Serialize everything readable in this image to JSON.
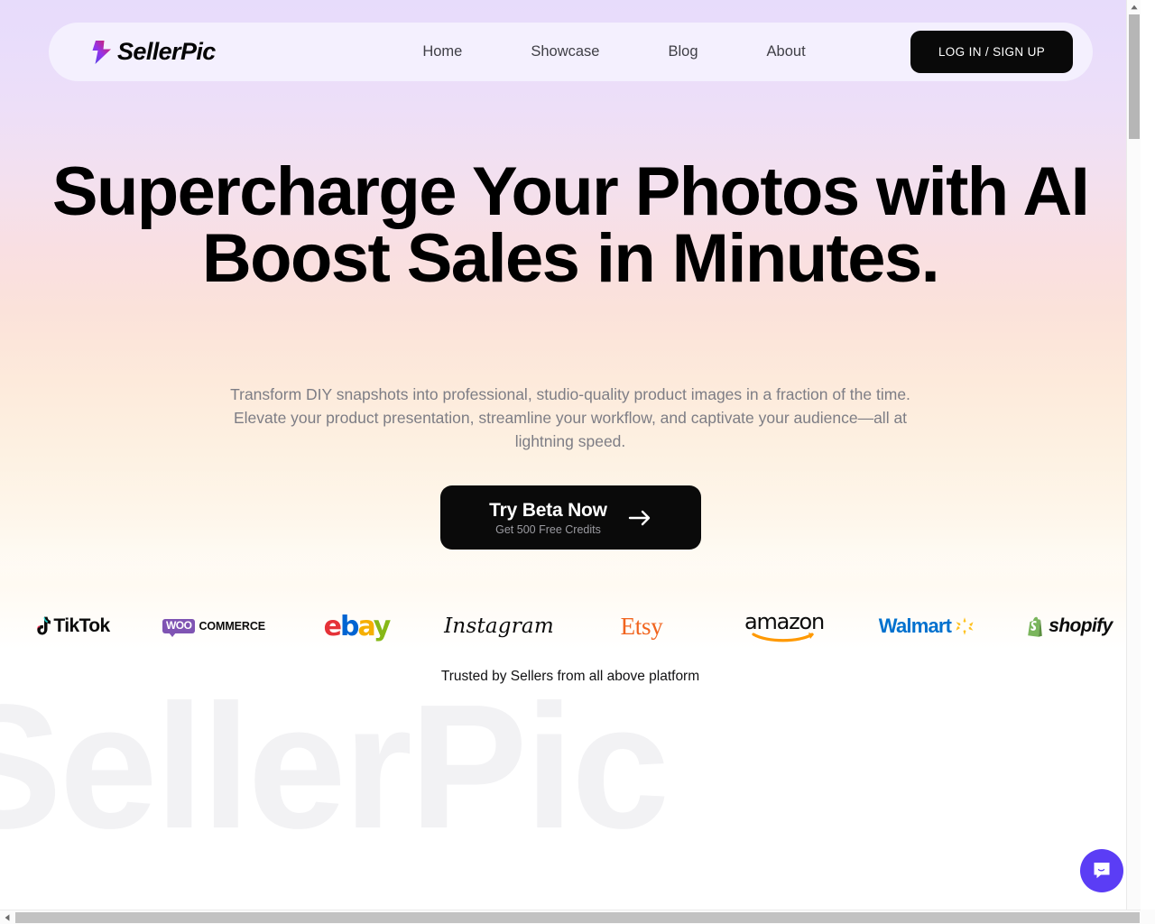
{
  "header": {
    "logo_text": "SellerPic",
    "logo_icon": "lightning-bolt-icon",
    "nav": [
      {
        "label": "Home"
      },
      {
        "label": "Showcase"
      },
      {
        "label": "Blog"
      },
      {
        "label": "About"
      }
    ],
    "login_label": "LOG IN / SIGN UP"
  },
  "hero": {
    "headline_line1": "Supercharge Your Photos with AI",
    "headline_line2": "Boost Sales in Minutes.",
    "subhead": "Transform DIY snapshots into professional, studio-quality product images in a fraction of the time. Elevate your product presentation, streamline your workflow, and captivate your audience—all at lightning speed.",
    "cta_title": "Try Beta Now",
    "cta_sub": "Get 500 Free Credits",
    "cta_arrow_icon": "arrow-right-icon"
  },
  "brands": {
    "trusted_label": "Trusted by Sellers from all above platform",
    "items": [
      {
        "name": "TikTok",
        "label": "TikTok"
      },
      {
        "name": "WooCommerce",
        "badge": "WOO",
        "label": "COMMERCE"
      },
      {
        "name": "eBay",
        "letters": {
          "e": "e",
          "b": "b",
          "a": "a",
          "y": "y"
        }
      },
      {
        "name": "Instagram",
        "label": "Instagram"
      },
      {
        "name": "Etsy",
        "label": "Etsy"
      },
      {
        "name": "amazon",
        "label": "amazon"
      },
      {
        "name": "Walmart",
        "label": "Walmart"
      },
      {
        "name": "shopify",
        "label": "shopify"
      }
    ]
  },
  "watermark": {
    "text": "SellerPic"
  },
  "chat": {
    "icon": "chat-bubble-smile-icon"
  },
  "colors": {
    "accent_purple": "#5b3df5",
    "brand_black": "#0a0a0a",
    "header_bg": "#f4f0fe",
    "gradient_top": "#e7dcfb",
    "gradient_mid": "#f9dfe2",
    "gradient_bottom": "#fdf1e2",
    "ebay_red": "#e53238",
    "ebay_blue": "#0064d2",
    "ebay_yellow": "#f5af02",
    "ebay_green": "#86b817",
    "etsy_orange": "#f1641e",
    "walmart_blue": "#0071ce",
    "walmart_spark": "#ffc220",
    "shopify_green": "#7ab55c",
    "woo_purple": "#7f54b3"
  }
}
